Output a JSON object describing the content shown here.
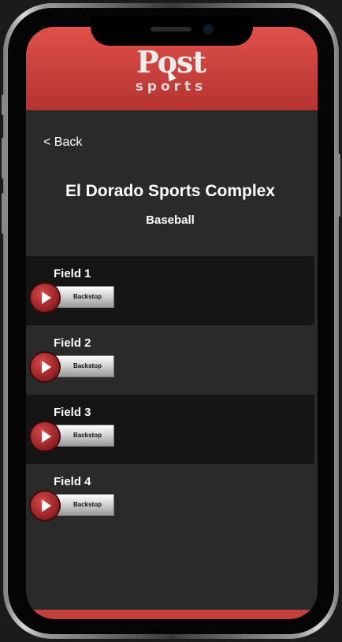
{
  "header": {
    "logo_main": "Post",
    "logo_sub": "sports"
  },
  "nav": {
    "back_label": "< Back"
  },
  "page": {
    "title": "El Dorado Sports Complex",
    "subtitle": "Baseball"
  },
  "fields": [
    {
      "name": "Field 1",
      "camera_label": "Backstop"
    },
    {
      "name": "Field 2",
      "camera_label": "Backstop"
    },
    {
      "name": "Field 3",
      "camera_label": "Backstop"
    },
    {
      "name": "Field 4",
      "camera_label": "Backstop"
    }
  ],
  "colors": {
    "header_red": "#c9403d",
    "background": "#2a2a2a",
    "row_dark": "#151515",
    "play_red": "#a3262a"
  },
  "icons": {
    "play": "play-icon"
  }
}
